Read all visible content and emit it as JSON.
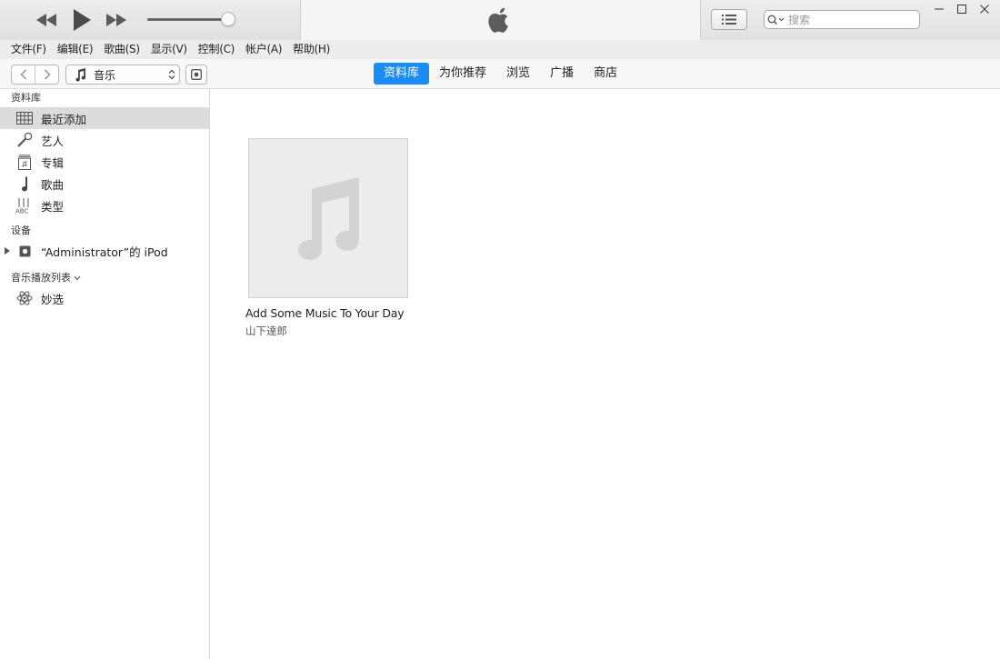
{
  "player": {
    "volume_percent": 93
  },
  "search": {
    "placeholder": "搜索"
  },
  "menubar": {
    "items": [
      {
        "label": "文件(F)"
      },
      {
        "label": "编辑(E)"
      },
      {
        "label": "歌曲(S)"
      },
      {
        "label": "显示(V)"
      },
      {
        "label": "控制(C)"
      },
      {
        "label": "帐户(A)"
      },
      {
        "label": "帮助(H)"
      }
    ]
  },
  "toolbar": {
    "media_kind": "音乐",
    "tabs": [
      {
        "label": "资料库"
      },
      {
        "label": "为你推荐"
      },
      {
        "label": "浏览"
      },
      {
        "label": "广播"
      },
      {
        "label": "商店"
      }
    ]
  },
  "sidebar": {
    "library_heading": "资料库",
    "library_items": [
      {
        "label": "最近添加",
        "icon": "grid-icon"
      },
      {
        "label": "艺人",
        "icon": "microphone-icon"
      },
      {
        "label": "专辑",
        "icon": "album-icon"
      },
      {
        "label": "歌曲",
        "icon": "music-note-icon"
      },
      {
        "label": "类型",
        "icon": "genre-icon"
      }
    ],
    "devices_heading": "设备",
    "device": {
      "label": "“Administrator”的 iPod",
      "icon": "ipod-icon"
    },
    "playlists_heading": "音乐播放列表",
    "playlist_items": [
      {
        "label": "妙选",
        "icon": "genius-atom-icon"
      }
    ]
  },
  "main": {
    "albums": [
      {
        "title": "Add Some Music To Your Day",
        "artist": "山下達郎"
      }
    ]
  },
  "colors": {
    "accent": "#1b8bf5",
    "selection": "#dcdcdc",
    "artwork_bg": "#ececec"
  }
}
